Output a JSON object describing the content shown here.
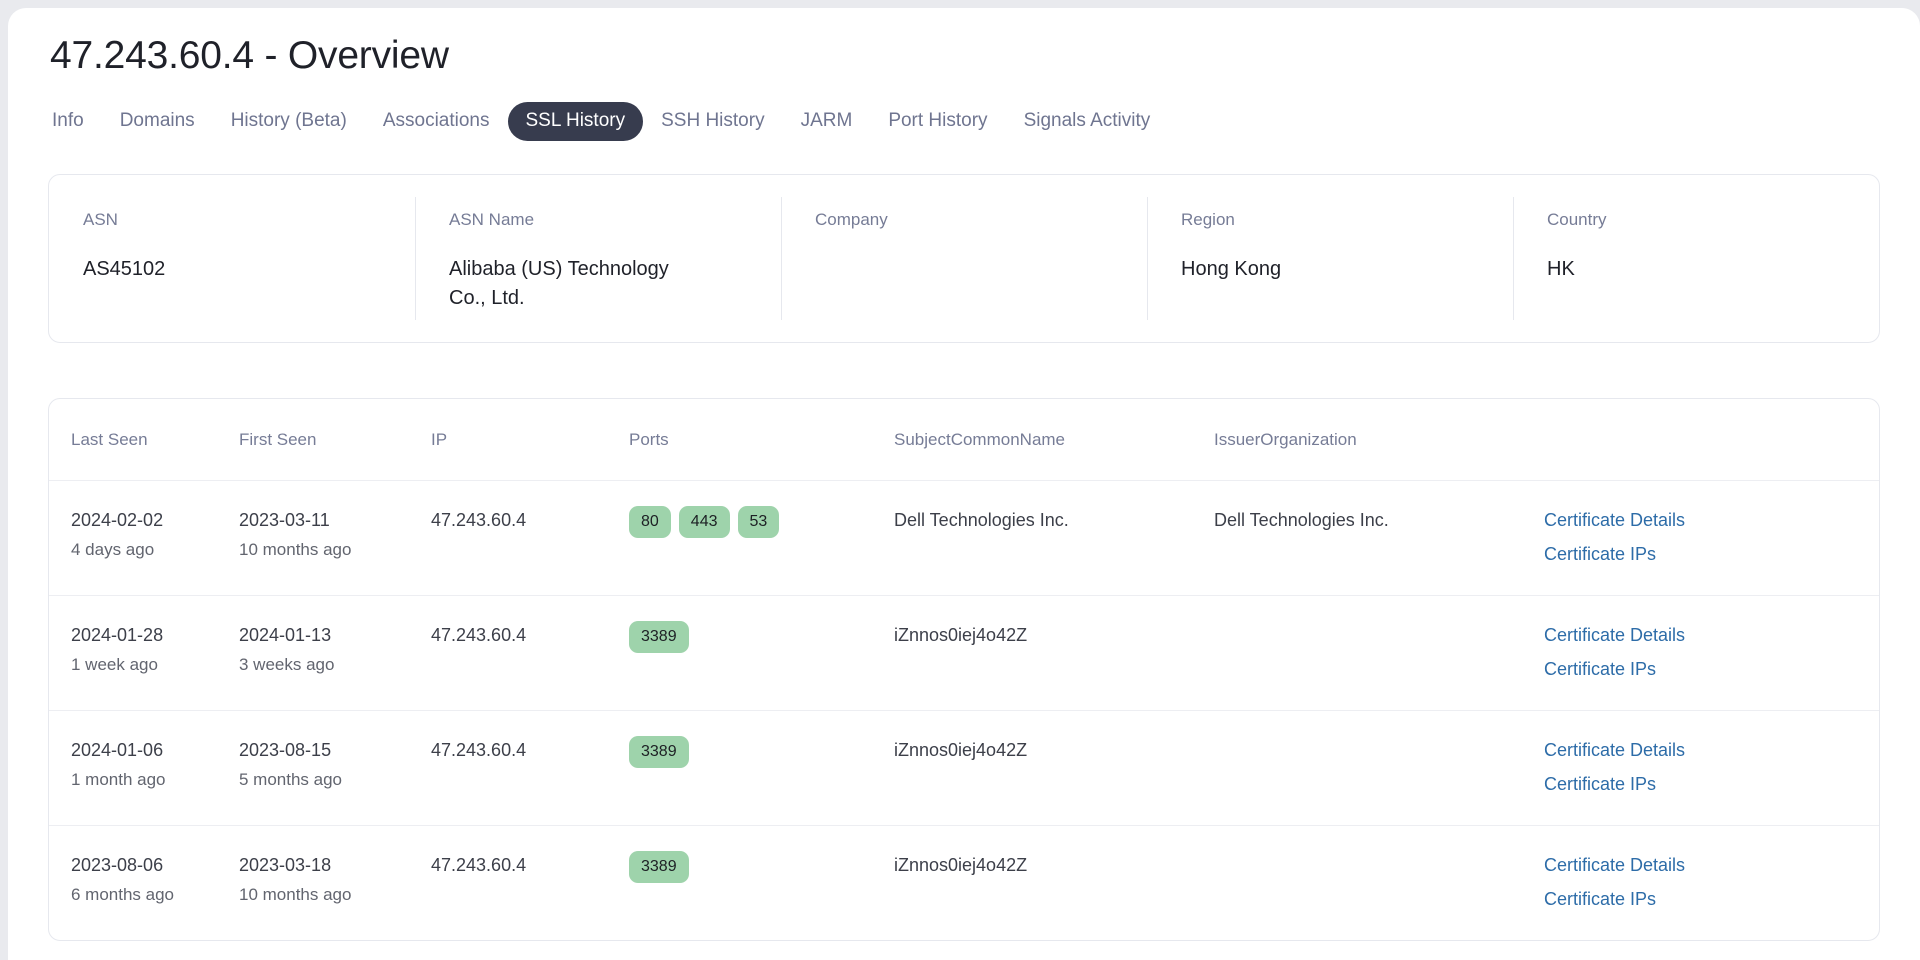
{
  "page": {
    "title": "47.243.60.4 - Overview"
  },
  "tabs": [
    {
      "label": "Info",
      "active": false
    },
    {
      "label": "Domains",
      "active": false
    },
    {
      "label": "History (Beta)",
      "active": false
    },
    {
      "label": "Associations",
      "active": false
    },
    {
      "label": "SSL History",
      "active": true
    },
    {
      "label": "SSH History",
      "active": false
    },
    {
      "label": "JARM",
      "active": false
    },
    {
      "label": "Port History",
      "active": false
    },
    {
      "label": "Signals Activity",
      "active": false
    }
  ],
  "info_card": [
    {
      "label": "ASN",
      "value": "AS45102"
    },
    {
      "label": "ASN Name",
      "value": "Alibaba (US) Technology Co., Ltd."
    },
    {
      "label": "Company",
      "value": ""
    },
    {
      "label": "Region",
      "value": "Hong Kong"
    },
    {
      "label": "Country",
      "value": "HK"
    }
  ],
  "table": {
    "columns": [
      "Last Seen",
      "First Seen",
      "IP",
      "Ports",
      "SubjectCommonName",
      "IssuerOrganization",
      ""
    ],
    "link_labels": {
      "details": "Certificate Details",
      "ips": "Certificate IPs"
    },
    "rows": [
      {
        "last_seen": "2024-02-02",
        "last_seen_rel": "4 days ago",
        "first_seen": "2023-03-11",
        "first_seen_rel": "10 months ago",
        "ip": "47.243.60.4",
        "ports": [
          "80",
          "443",
          "53"
        ],
        "subject_common_name": "Dell Technologies Inc.",
        "issuer_organization": "Dell Technologies Inc."
      },
      {
        "last_seen": "2024-01-28",
        "last_seen_rel": "1 week ago",
        "first_seen": "2024-01-13",
        "first_seen_rel": "3 weeks ago",
        "ip": "47.243.60.4",
        "ports": [
          "3389"
        ],
        "subject_common_name": "iZnnos0iej4o42Z",
        "issuer_organization": ""
      },
      {
        "last_seen": "2024-01-06",
        "last_seen_rel": "1 month ago",
        "first_seen": "2023-08-15",
        "first_seen_rel": "5 months ago",
        "ip": "47.243.60.4",
        "ports": [
          "3389"
        ],
        "subject_common_name": "iZnnos0iej4o42Z",
        "issuer_organization": ""
      },
      {
        "last_seen": "2023-08-06",
        "last_seen_rel": "6 months ago",
        "first_seen": "2023-03-18",
        "first_seen_rel": "10 months ago",
        "ip": "47.243.60.4",
        "ports": [
          "3389"
        ],
        "subject_common_name": "iZnnos0iej4o42Z",
        "issuer_organization": ""
      }
    ]
  },
  "colors": {
    "active_tab_bg": "#373c4e",
    "port_badge_bg": "#9ed3ab",
    "link": "#2d6ca8",
    "label": "#767c96",
    "page_bg": "#e9eaee"
  }
}
